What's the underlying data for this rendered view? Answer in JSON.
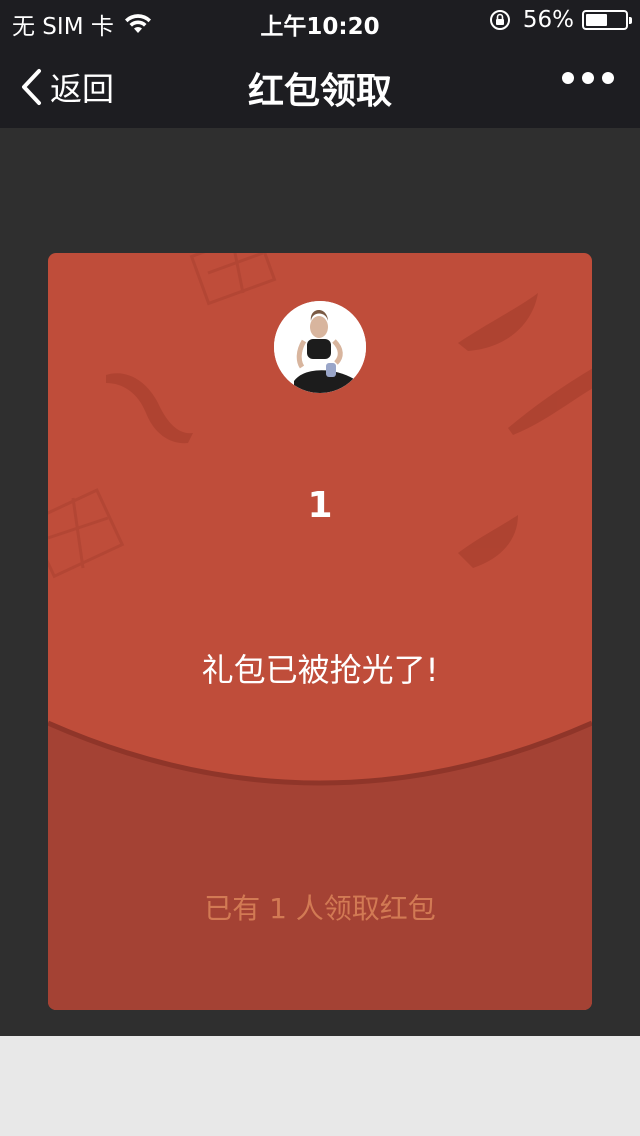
{
  "status_bar": {
    "carrier": "无 SIM 卡",
    "time": "上午10:20",
    "battery_percent": "56%",
    "battery_level": 0.56
  },
  "nav": {
    "back_label": "返回",
    "title": "红包领取",
    "more_icon": "more-dots-icon"
  },
  "envelope": {
    "amount": "1",
    "message": "礼包已被抢光了!",
    "claimed_info": "已有 1 人领取红包",
    "colors": {
      "top": "#bf4d3a",
      "bottom": "#a44234",
      "claim_text": "#d27a54"
    }
  }
}
